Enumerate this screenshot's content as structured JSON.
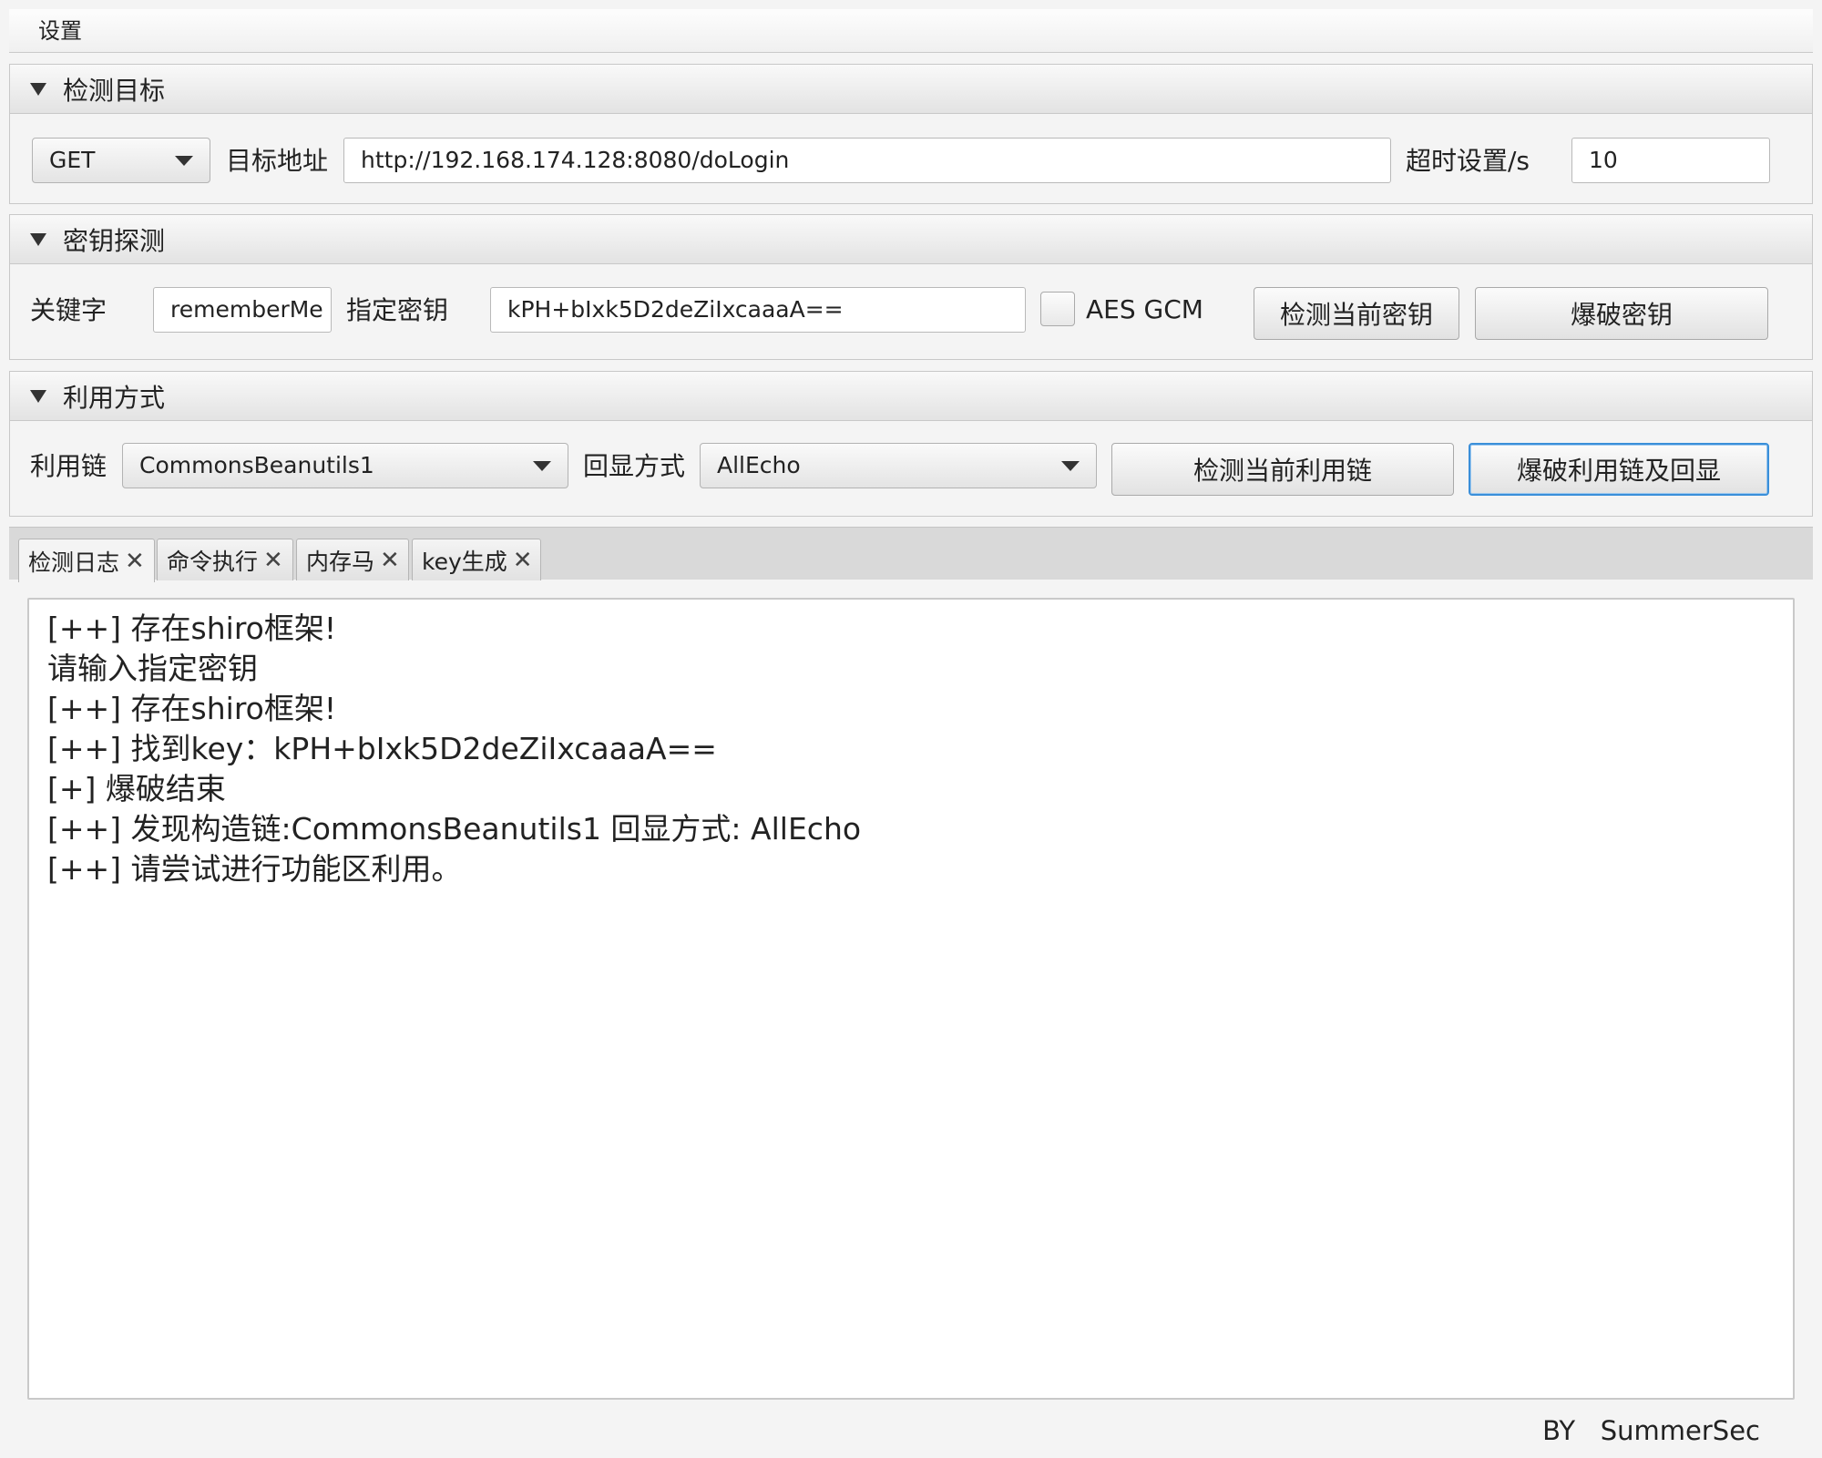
{
  "menubar": {
    "settings": "设置"
  },
  "target_pane": {
    "title": "检测目标",
    "method": "GET",
    "url_label": "目标地址",
    "url_value": "http://192.168.174.128:8080/doLogin",
    "timeout_label": "超时设置/s",
    "timeout_value": "10"
  },
  "key_pane": {
    "title": "密钥探测",
    "keyword_label": "关键字",
    "keyword_value": "rememberMe",
    "key_label": "指定密钥",
    "key_value": "kPH+bIxk5D2deZiIxcaaaA==",
    "gcm_label": "AES GCM",
    "gcm_checked": false,
    "detect_button": "检测当前密钥",
    "brute_button": "爆破密钥"
  },
  "exploit_pane": {
    "title": "利用方式",
    "chain_label": "利用链",
    "chain_value": "CommonsBeanutils1",
    "echo_label": "回显方式",
    "echo_value": "AllEcho",
    "detect_button": "检测当前利用链",
    "brute_button": "爆破利用链及回显"
  },
  "tabs": [
    {
      "label": "检测日志",
      "active": true
    },
    {
      "label": "命令执行",
      "active": false
    },
    {
      "label": "内存马",
      "active": false
    },
    {
      "label": "key生成",
      "active": false
    }
  ],
  "log_lines": [
    "[++] 存在shiro框架!",
    "请输入指定密钥",
    "[++] 存在shiro框架!",
    "[++] 找到key：kPH+bIxk5D2deZiIxcaaaA==",
    "[+] 爆破结束",
    "[++] 发现构造链:CommonsBeanutils1  回显方式: AllEcho",
    "[++] 请尝试进行功能区利用。"
  ],
  "footer": "BY   SummerSec",
  "colors": {
    "focus_border": "#3a8fd9",
    "background": "#f4f4f4"
  }
}
